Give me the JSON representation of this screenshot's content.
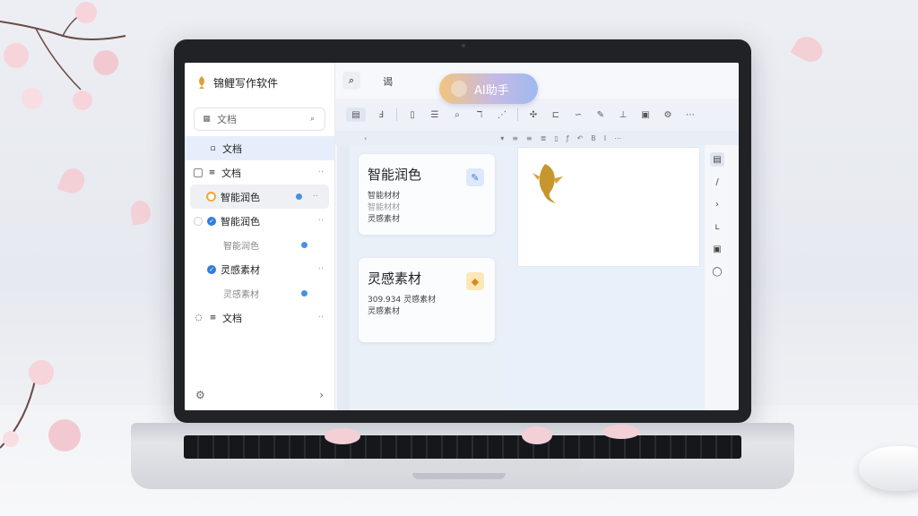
{
  "app": {
    "title": "锦鲤写作软件",
    "search_placeholder": "文档"
  },
  "sidebar": {
    "items": [
      {
        "label": "文档",
        "icon": "document-icon",
        "state": "active"
      },
      {
        "label": "文档",
        "icon": "folder-icon",
        "more": "··"
      },
      {
        "label": "智能润色",
        "icon": "smart-polish-icon",
        "more": "··",
        "highlight": true
      },
      {
        "label": "智能润色",
        "icon": "check-icon",
        "more": "··"
      },
      {
        "label": "智能润色",
        "sub": true
      },
      {
        "label": "灵感素材",
        "icon": "check-icon",
        "more": "··"
      },
      {
        "label": "灵感素材",
        "sub": true
      },
      {
        "label": "文档",
        "icon": "comment-icon",
        "more": "··"
      }
    ],
    "footer_left": "settings-icon",
    "footer_right": "›"
  },
  "topbar": {
    "tab_label": "谒",
    "ai_button_label": "AI助手"
  },
  "cards": [
    {
      "title": "智能润色",
      "lines": [
        "智能材材",
        "智能材材",
        "灵感素材"
      ],
      "badge_icon": "brush-icon"
    },
    {
      "title": "灵感素材",
      "lines": [
        "309.934  灵感素材",
        "灵感素材"
      ],
      "badge_icon": "lightbulb-icon"
    }
  ],
  "colors": {
    "accent": "#2f7de1",
    "ai_gradient_start": "#f2c57e",
    "ai_gradient_end": "#9fb9ef",
    "blossom": "#f3cfd6",
    "koi_gold": "#c7962e"
  }
}
